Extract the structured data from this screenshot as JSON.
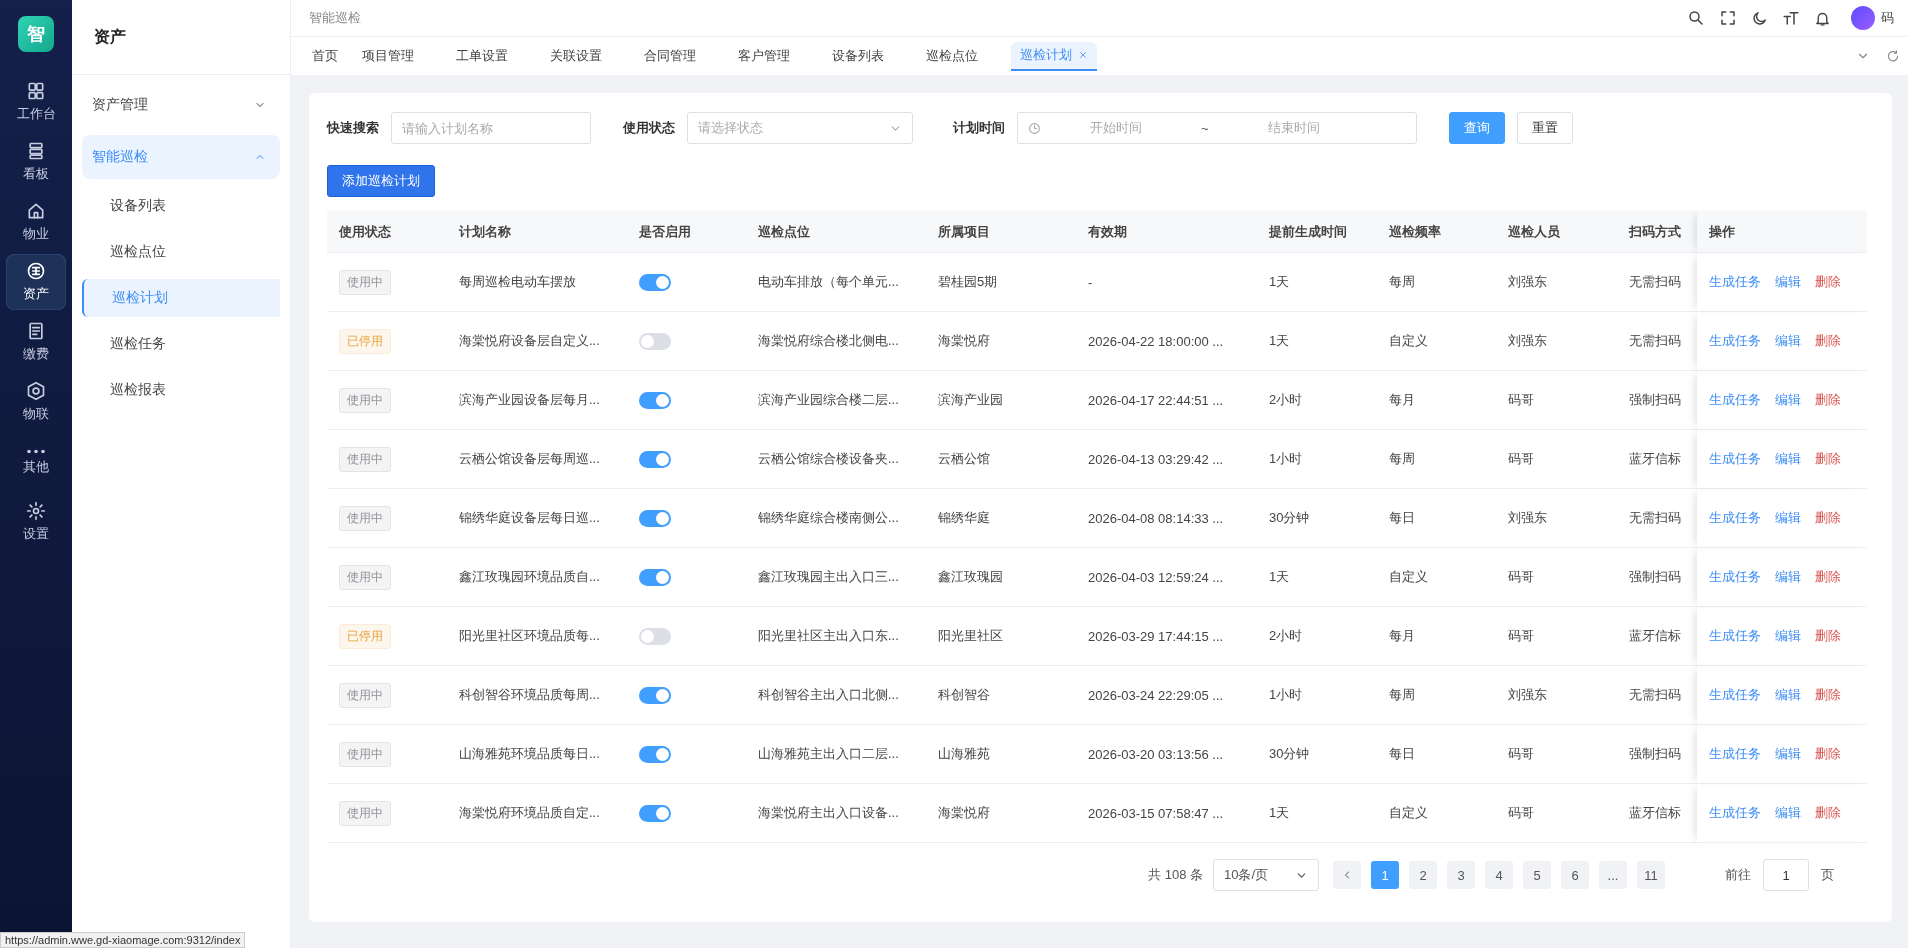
{
  "rail": {
    "logo": "智",
    "items": [
      {
        "label": "工作台",
        "selected": false
      },
      {
        "label": "看板",
        "selected": false
      },
      {
        "label": "物业",
        "selected": false
      },
      {
        "label": "资产",
        "selected": true
      },
      {
        "label": "缴费",
        "selected": false
      },
      {
        "label": "物联",
        "selected": false
      },
      {
        "label": "其他",
        "selected": false
      },
      {
        "label": "设置",
        "selected": false
      }
    ]
  },
  "sidebar": {
    "title": "资产",
    "items": [
      {
        "label": "资产管理",
        "expanded": false,
        "selected": false
      },
      {
        "label": "智能巡检",
        "expanded": true,
        "selected": true,
        "children": [
          {
            "label": "设备列表",
            "selected": false
          },
          {
            "label": "巡检点位",
            "selected": false
          },
          {
            "label": "巡检计划",
            "selected": true
          },
          {
            "label": "巡检任务",
            "selected": false
          },
          {
            "label": "巡检报表",
            "selected": false
          }
        ]
      }
    ]
  },
  "header": {
    "breadcrumb": "智能巡检",
    "user": "码"
  },
  "tabs": [
    {
      "label": "首页",
      "selected": false
    },
    {
      "label": "项目管理",
      "selected": false
    },
    {
      "label": "工单设置",
      "selected": false
    },
    {
      "label": "关联设置",
      "selected": false
    },
    {
      "label": "合同管理",
      "selected": false
    },
    {
      "label": "客户管理",
      "selected": false
    },
    {
      "label": "设备列表",
      "selected": false
    },
    {
      "label": "巡检点位",
      "selected": false
    },
    {
      "label": "巡检计划",
      "selected": true
    }
  ],
  "filters": {
    "search_label": "快速搜索",
    "search_placeholder": "请输入计划名称",
    "status_label": "使用状态",
    "status_placeholder": "请选择状态",
    "time_label": "计划时间",
    "start_placeholder": "开始时间",
    "range_separator": "~",
    "end_placeholder": "结束时间",
    "query_button": "查询",
    "reset_button": "重置"
  },
  "add_button": "添加巡检计划",
  "table": {
    "columns": [
      "使用状态",
      "计划名称",
      "是否启用",
      "巡检点位",
      "所属项目",
      "有效期",
      "提前生成时间",
      "巡检频率",
      "巡检人员",
      "扫码方式",
      "操作"
    ],
    "rows": [
      {
        "status": "使用中",
        "kind": "active",
        "name": "每周巡检电动车摆放",
        "enabled": true,
        "point": "电动车排放（每个单元...",
        "project": "碧桂园5期",
        "validity": "-",
        "advance": "1天",
        "frequency": "每周",
        "inspector": "刘强东",
        "scan": "无需扫码",
        "actions": [
          "生成任务",
          "编辑",
          "删除"
        ]
      },
      {
        "status": "已停用",
        "kind": "stopped",
        "name": "海棠悦府设备层自定义...",
        "enabled": false,
        "point": "海棠悦府综合楼北侧电...",
        "project": "海棠悦府",
        "validity": "2026-04-22 18:00:00 ...",
        "advance": "1天",
        "frequency": "自定义",
        "inspector": "刘强东",
        "scan": "无需扫码",
        "actions": [
          "生成任务",
          "编辑",
          "删除"
        ]
      },
      {
        "status": "使用中",
        "kind": "active",
        "name": "滨海产业园设备层每月...",
        "enabled": true,
        "point": "滨海产业园综合楼二层...",
        "project": "滨海产业园",
        "validity": "2026-04-17 22:44:51 ...",
        "advance": "2小时",
        "frequency": "每月",
        "inspector": "码哥",
        "scan": "强制扫码",
        "actions": [
          "生成任务",
          "编辑",
          "删除"
        ]
      },
      {
        "status": "使用中",
        "kind": "active",
        "name": "云栖公馆设备层每周巡...",
        "enabled": true,
        "point": "云栖公馆综合楼设备夹...",
        "project": "云栖公馆",
        "validity": "2026-04-13 03:29:42 ...",
        "advance": "1小时",
        "frequency": "每周",
        "inspector": "码哥",
        "scan": "蓝牙信标",
        "actions": [
          "生成任务",
          "编辑",
          "删除"
        ]
      },
      {
        "status": "使用中",
        "kind": "active",
        "name": "锦绣华庭设备层每日巡...",
        "enabled": true,
        "point": "锦绣华庭综合楼南侧公...",
        "project": "锦绣华庭",
        "validity": "2026-04-08 08:14:33 ...",
        "advance": "30分钟",
        "frequency": "每日",
        "inspector": "刘强东",
        "scan": "无需扫码",
        "actions": [
          "生成任务",
          "编辑",
          "删除"
        ]
      },
      {
        "status": "使用中",
        "kind": "active",
        "name": "鑫江玫瑰园环境品质自...",
        "enabled": true,
        "point": "鑫江玫瑰园主出入口三...",
        "project": "鑫江玫瑰园",
        "validity": "2026-04-03 12:59:24 ...",
        "advance": "1天",
        "frequency": "自定义",
        "inspector": "码哥",
        "scan": "强制扫码",
        "actions": [
          "生成任务",
          "编辑",
          "删除"
        ]
      },
      {
        "status": "已停用",
        "kind": "stopped",
        "name": "阳光里社区环境品质每...",
        "enabled": false,
        "point": "阳光里社区主出入口东...",
        "project": "阳光里社区",
        "validity": "2026-03-29 17:44:15 ...",
        "advance": "2小时",
        "frequency": "每月",
        "inspector": "码哥",
        "scan": "蓝牙信标",
        "actions": [
          "生成任务",
          "编辑",
          "删除"
        ]
      },
      {
        "status": "使用中",
        "kind": "active",
        "name": "科创智谷环境品质每周...",
        "enabled": true,
        "point": "科创智谷主出入口北侧...",
        "project": "科创智谷",
        "validity": "2026-03-24 22:29:05 ...",
        "advance": "1小时",
        "frequency": "每周",
        "inspector": "刘强东",
        "scan": "无需扫码",
        "actions": [
          "生成任务",
          "编辑",
          "删除"
        ]
      },
      {
        "status": "使用中",
        "kind": "active",
        "name": "山海雅苑环境品质每日...",
        "enabled": true,
        "point": "山海雅苑主出入口二层...",
        "project": "山海雅苑",
        "validity": "2026-03-20 03:13:56 ...",
        "advance": "30分钟",
        "frequency": "每日",
        "inspector": "码哥",
        "scan": "强制扫码",
        "actions": [
          "生成任务",
          "编辑",
          "删除"
        ]
      },
      {
        "status": "使用中",
        "kind": "active",
        "name": "海棠悦府环境品质自定...",
        "enabled": true,
        "point": "海棠悦府主出入口设备...",
        "project": "海棠悦府",
        "validity": "2026-03-15 07:58:47 ...",
        "advance": "1天",
        "frequency": "自定义",
        "inspector": "码哥",
        "scan": "蓝牙信标",
        "actions": [
          "生成任务",
          "编辑",
          "删除"
        ]
      }
    ]
  },
  "pagination": {
    "total": "共 108 条",
    "page_size": "10条/页",
    "pages": [
      {
        "label": "1",
        "selected": true
      },
      {
        "label": "2",
        "selected": false
      },
      {
        "label": "3",
        "selected": false
      },
      {
        "label": "4",
        "selected": false
      },
      {
        "label": "5",
        "selected": false
      },
      {
        "label": "6",
        "selected": false
      },
      {
        "label": "...",
        "selected": false
      },
      {
        "label": "11",
        "selected": false
      }
    ],
    "goto_label": "前往",
    "goto_value": "1",
    "goto_suffix": "页"
  },
  "status_url": "https://admin.wwe.gd-xiaomage.com:9312/index"
}
